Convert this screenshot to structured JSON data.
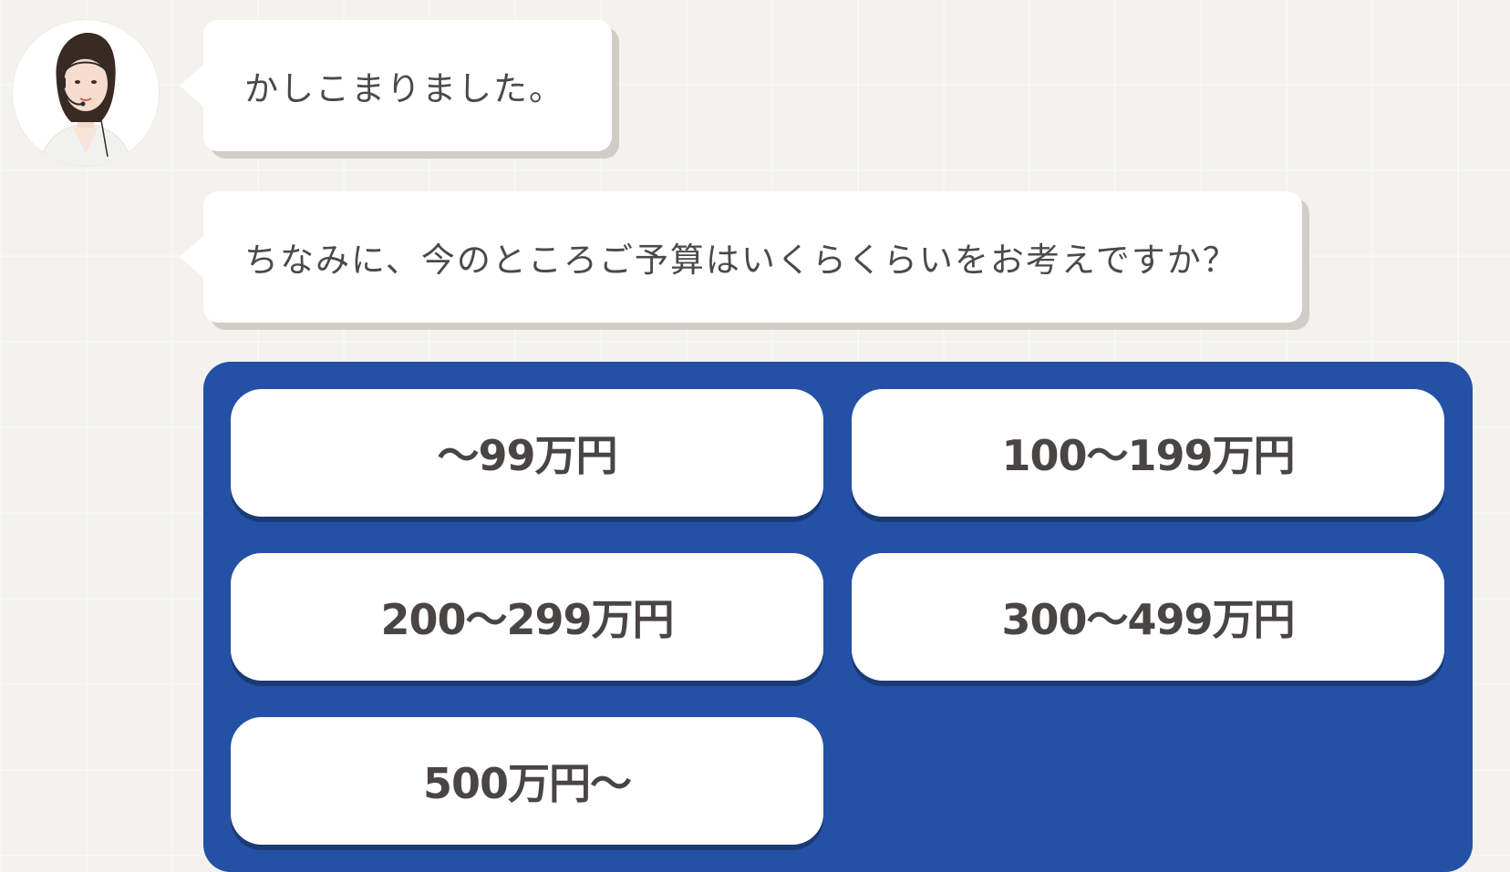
{
  "chat": {
    "avatar_icon": "operator-avatar-icon",
    "messages": [
      "かしこまりました。",
      "ちなみに、今のところご予算はいくらくらいをお考えですか？"
    ]
  },
  "budget_options": [
    "〜99万円",
    "100〜199万円",
    "200〜299万円",
    "300〜499万円",
    "500万円〜"
  ],
  "colors": {
    "background": "#f3f2ee",
    "bubble": "#ffffff",
    "bubble_shadow": "#cfcdc6",
    "panel": "#2451a6",
    "option_text": "#4a4545",
    "message_text": "#4a4a4a"
  }
}
